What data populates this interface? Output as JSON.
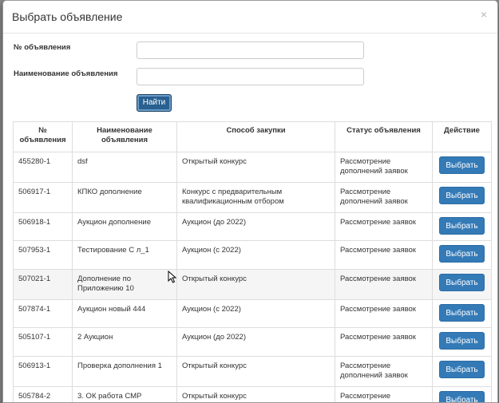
{
  "modal": {
    "title": "Выбрать объявление",
    "close_icon": "×"
  },
  "form": {
    "number_label": "№ объявления",
    "number_value": "",
    "name_label": "Наименование объявления",
    "name_value": "",
    "search_button": "Найти"
  },
  "table": {
    "headers": [
      "№ объявления",
      "Наименование объявления",
      "Способ закупки",
      "Статус объявления",
      "Действие"
    ],
    "rows": [
      {
        "number": "455280-1",
        "name": "dsf",
        "method": "Открытый конкурс",
        "status": "Рассмотрение дополнений заявок",
        "action": "Выбрать"
      },
      {
        "number": "506917-1",
        "name": "КПКО дополнение",
        "method": "Конкурс с предварительным квалификационным отбором",
        "status": "Рассмотрение дополнений заявок",
        "action": "Выбрать"
      },
      {
        "number": "506918-1",
        "name": "Аукцион дополнение",
        "method": "Аукцион (до 2022)",
        "status": "Рассмотрение заявок",
        "action": "Выбрать"
      },
      {
        "number": "507953-1",
        "name": "Тестирование С        л_1",
        "method": "Аукцион (с 2022)",
        "status": "Рассмотрение заявок",
        "action": "Выбрать"
      },
      {
        "number": "507021-1",
        "name": "Дополнение по Приложению 10",
        "method": "Открытый конкурс",
        "status": "Рассмотрение заявок",
        "action": "Выбрать"
      },
      {
        "number": "507874-1",
        "name": "Аукцион новый 444",
        "method": "Аукцион (с 2022)",
        "status": "Рассмотрение заявок",
        "action": "Выбрать"
      },
      {
        "number": "505107-1",
        "name": "2 Аукцион",
        "method": "Аукцион (до 2022)",
        "status": "Рассмотрение заявок",
        "action": "Выбрать"
      },
      {
        "number": "506913-1",
        "name": "Проверка дополнения 1",
        "method": "Открытый конкурс",
        "status": "Рассмотрение дополнений заявок",
        "action": "Выбрать"
      },
      {
        "number": "505784-2",
        "name": "3. ОК работа СМР",
        "method": "Открытый конкурс",
        "status": "Рассмотрение дополнений заявок",
        "action": "Выбрать"
      }
    ]
  },
  "colors": {
    "primary_button": "#337ab7",
    "search_button": "#286090",
    "hover_row": "#f5f5f5"
  }
}
